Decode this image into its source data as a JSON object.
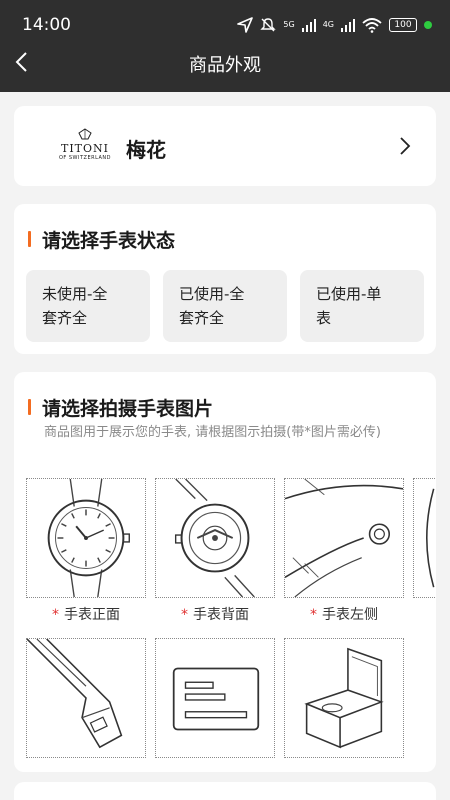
{
  "status_bar": {
    "time": "14:00",
    "network_5g": "5G",
    "network_4g": "4G",
    "battery": "100"
  },
  "header": {
    "title": "商品外观"
  },
  "brand": {
    "logo_text": "TITONI",
    "logo_subtext": "OF SWITZERLAND",
    "name": "梅花"
  },
  "watch_status": {
    "title": "请选择手表状态",
    "options": [
      {
        "line1": "未使用-全",
        "line2": "套齐全"
      },
      {
        "line1": "已使用-全",
        "line2": "套齐全"
      },
      {
        "line1": "已使用-单",
        "line2": "表"
      }
    ]
  },
  "photos": {
    "title": "请选择拍摄手表图片",
    "hint": "商品图用于展示您的手表, 请根据图示拍摄(带*图片需必传)",
    "required_mark": "*",
    "slots": [
      {
        "label": "手表正面"
      },
      {
        "label": "手表背面"
      },
      {
        "label": "手表左侧"
      }
    ]
  },
  "icon_names": [
    "back-icon",
    "chevron-right-icon",
    "crown-icon",
    "navigation-icon",
    "mute-icon",
    "wifi-icon",
    "battery-icon"
  ],
  "colors": {
    "header_bg": "#2f2f2f",
    "accent": "#f36c21",
    "required": "#e03030",
    "status_dot": "#2ecc40"
  }
}
